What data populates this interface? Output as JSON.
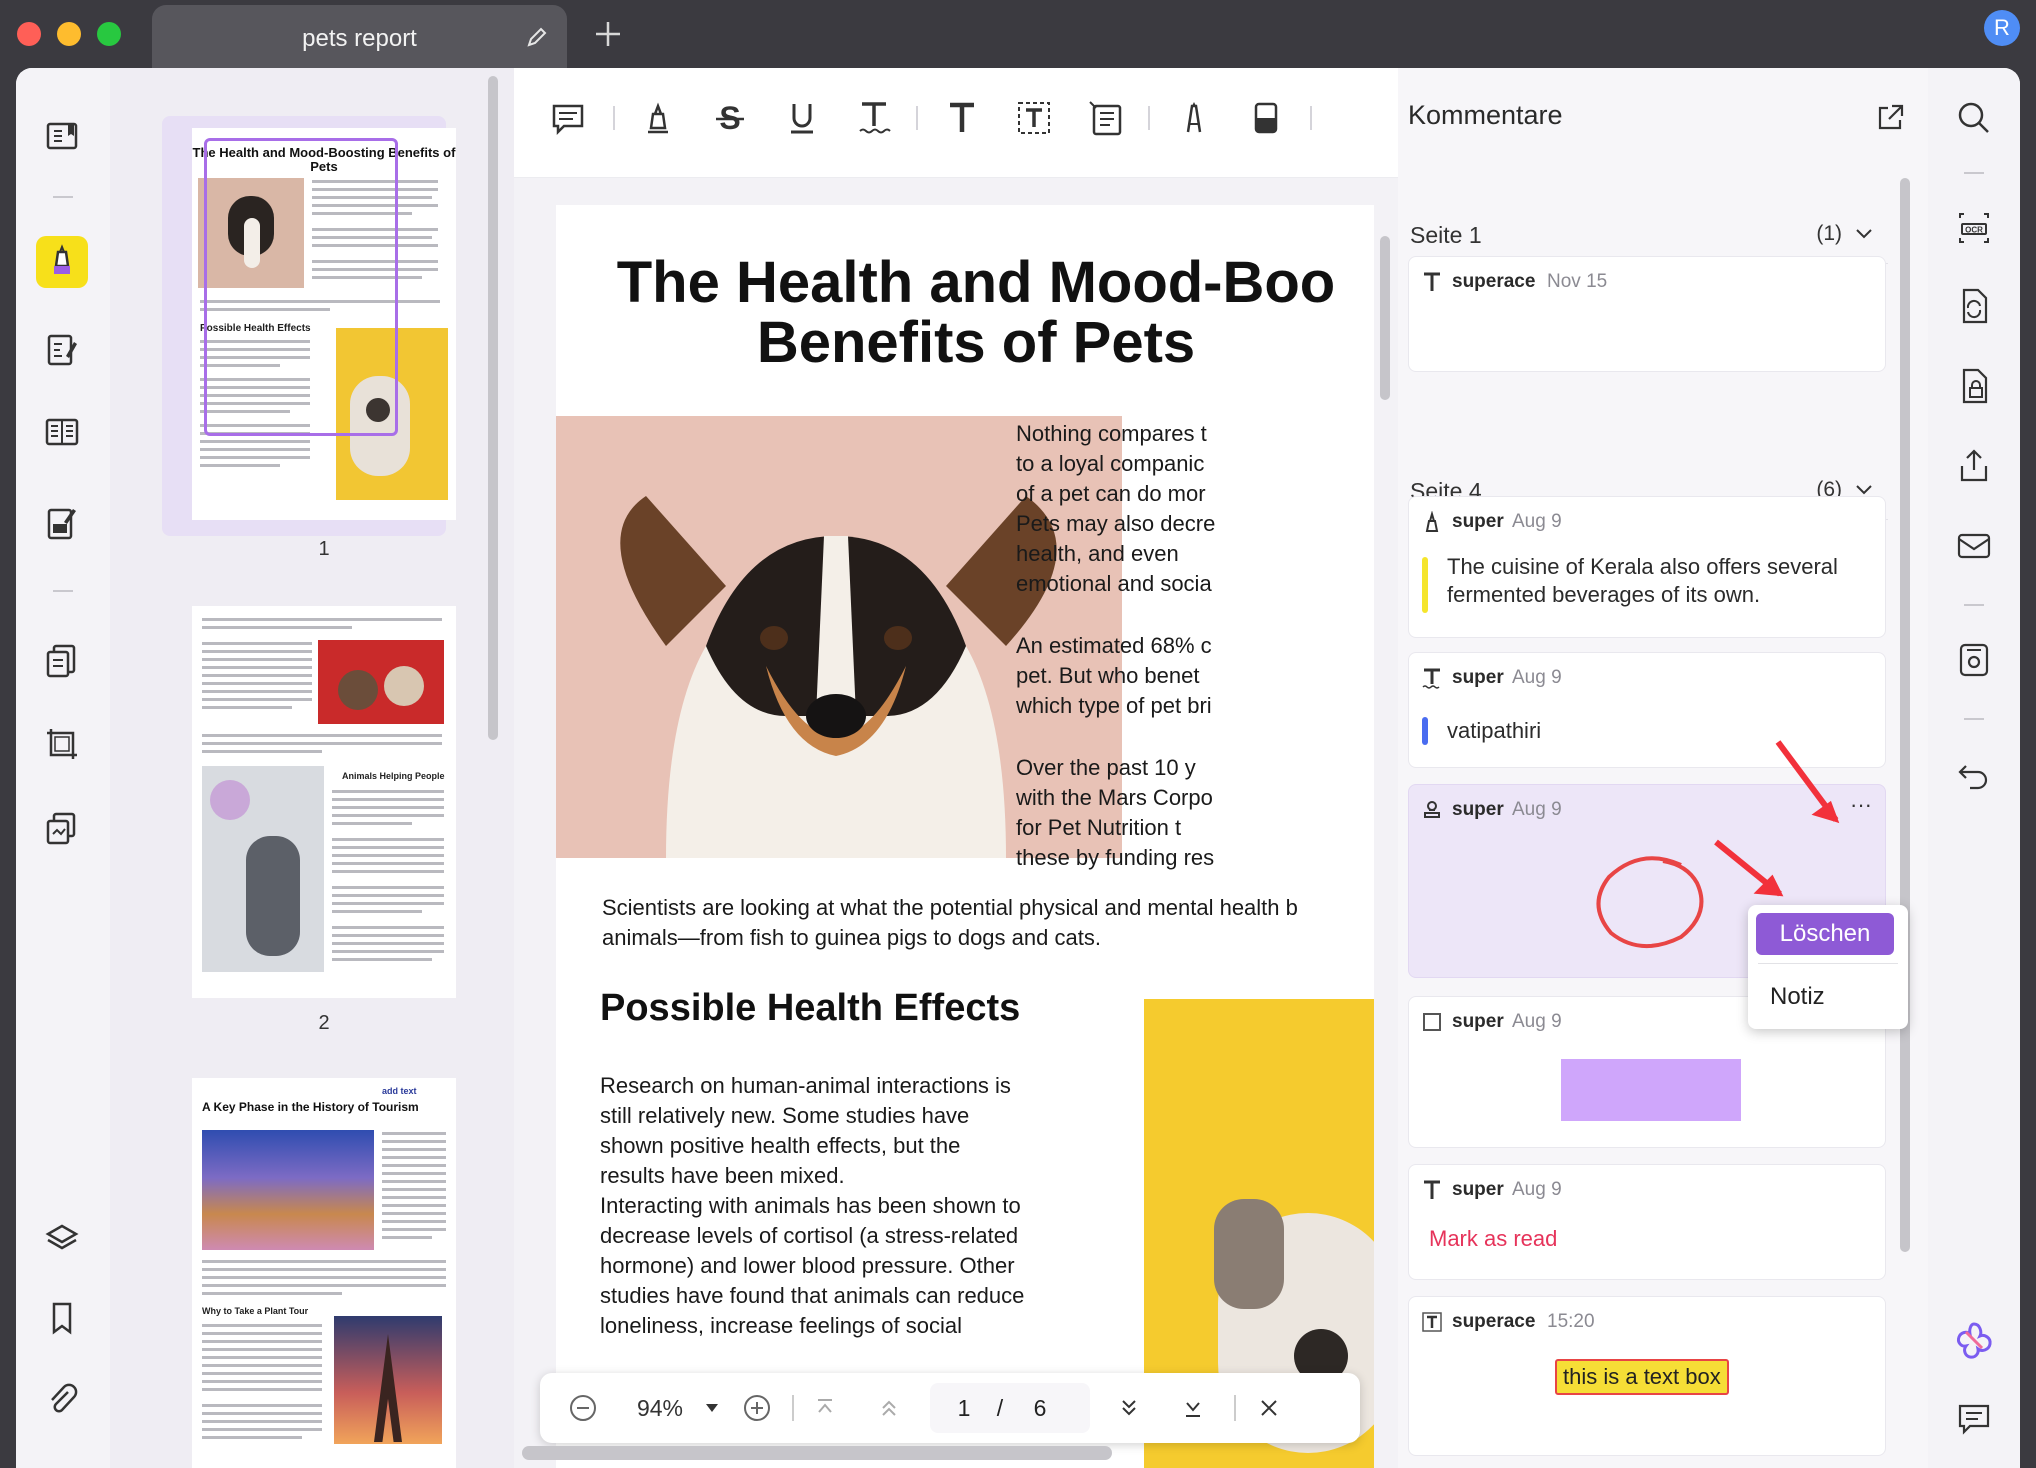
{
  "window": {
    "tab_title": "pets report",
    "avatar_initial": "R"
  },
  "thumbnails": {
    "page1": {
      "title": "The Health and Mood-Boosting Benefits of Pets",
      "section": "Possible Health Effects",
      "number": "1"
    },
    "page2": {
      "section": "Animals Helping People",
      "number": "2"
    },
    "page3": {
      "title": "A Key Phase in the History of Tourism",
      "add_text": "add text",
      "section": "Why to Take a Plant Tour"
    }
  },
  "document": {
    "title_line1": "The Health and Mood-Boo",
    "title_line2": "Benefits of Pets",
    "right_col": [
      "Nothing compares t",
      "to a loyal companic",
      "of a pet can do mor",
      "Pets may also decre",
      "health,  and  even",
      "emotional and socia",
      "",
      "An estimated 68% c",
      "pet.  But  who  benet",
      "which type of pet bri",
      "",
      "Over  the  past  10  y",
      "with the Mars Corpo",
      "for  Pet  Nutrition  t",
      "these by funding res"
    ],
    "intro_line1": "Scientists are looking at what the potential physical and mental health b",
    "intro_line2": "animals—from fish to guinea pigs to dogs and cats.",
    "section_heading": "Possible Health Effects",
    "para1": [
      "Research  on  human-animal  interactions  is",
      "still   relatively   new.   Some   studies   have",
      "shown   positive   health   effects,   but   the",
      "results have been mixed."
    ],
    "para2": [
      "Interacting with animals has been shown to",
      "decrease levels of cortisol (a stress-related",
      "hormone) and lower blood pressure. Other",
      "studies have found that animals can reduce",
      "loneliness,    increase    feelings    of    social"
    ]
  },
  "page_nav": {
    "zoom": "94%",
    "current_page": "1",
    "separator": "/",
    "total_pages": "6"
  },
  "comments": {
    "header": "Kommentare",
    "sections": [
      {
        "label": "Seite 1",
        "count": "(1)",
        "items": [
          {
            "icon": "text-icon",
            "author": "superace",
            "date": "Nov 15",
            "text": ""
          }
        ]
      },
      {
        "label": "Seite 4",
        "count": "(6)",
        "items": [
          {
            "icon": "highlighter-icon",
            "author": "super",
            "date": "Aug 9",
            "text": "The cuisine of Kerala also offers several fermented beverages of its own.",
            "bar_color": "#f5e52c"
          },
          {
            "icon": "text-icon",
            "author": "super",
            "date": "Aug 9",
            "text": "vatipathiri",
            "bar_color": "#4a6cf0"
          },
          {
            "icon": "stamp-icon",
            "author": "super",
            "date": "Aug 9",
            "text": ""
          },
          {
            "icon": "rectangle-icon",
            "author": "super",
            "date": "Aug 9",
            "text": ""
          },
          {
            "icon": "text-icon",
            "author": "super",
            "date": "Aug 9",
            "text": "Mark as read",
            "text_color": "#e6335a"
          },
          {
            "icon": "textbox-icon",
            "author": "superace",
            "date": "15:20",
            "text": "this is a text box"
          }
        ]
      }
    ],
    "context_menu": {
      "delete": "Löschen",
      "note": "Notiz",
      "more": "···"
    }
  },
  "colors": {
    "accent": "#9b5de5",
    "menu_delete": "#8e5ad6",
    "highlight_yellow": "#f5e52c",
    "rect_fill": "#cfa6fb",
    "circle": "#e84545"
  }
}
